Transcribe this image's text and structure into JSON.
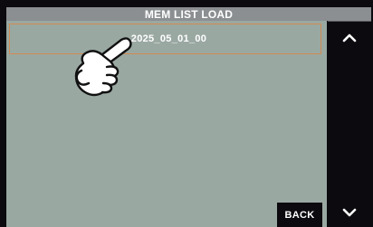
{
  "header": {
    "title": "MEM LIST LOAD"
  },
  "list": {
    "items": [
      {
        "label": "2025_05_01_00",
        "selected": true
      }
    ]
  },
  "nav": {
    "up_icon": "chevron-up-icon",
    "down_icon": "chevron-down-icon",
    "back_label": "BACK"
  },
  "colors": {
    "screen_bg": "#0c0a0e",
    "title_bg": "#8b8f91",
    "panel_bg": "#9aa8a2",
    "selection_border": "#d28a52",
    "text": "#ffffff"
  }
}
